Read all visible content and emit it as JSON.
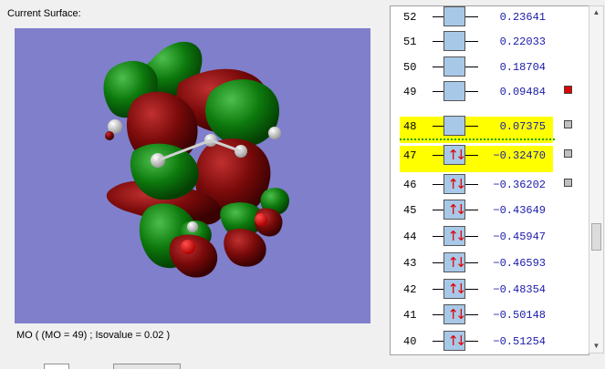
{
  "surface": {
    "title": "Current Surface:",
    "caption": "MO ( (MO = 49) ; Isovalue = 0.02 )"
  },
  "mo_list": {
    "rows": [
      {
        "num": "52",
        "energy": "0.23641",
        "occupied": false,
        "highlight": false,
        "check": ""
      },
      {
        "num": "51",
        "energy": "0.22033",
        "occupied": false,
        "highlight": false,
        "check": ""
      },
      {
        "num": "50",
        "energy": "0.18704",
        "occupied": false,
        "highlight": false,
        "check": ""
      },
      {
        "num": "49",
        "energy": "0.09484",
        "occupied": false,
        "highlight": false,
        "check": "red"
      },
      {
        "num": "48",
        "energy": "0.07375",
        "occupied": false,
        "highlight": true,
        "check": "gray"
      },
      {
        "num": "47",
        "energy": "−0.32470",
        "occupied": true,
        "highlight": true,
        "check": "gray"
      },
      {
        "num": "46",
        "energy": "−0.36202",
        "occupied": true,
        "highlight": false,
        "check": "gray"
      },
      {
        "num": "45",
        "energy": "−0.43649",
        "occupied": true,
        "highlight": false,
        "check": ""
      },
      {
        "num": "44",
        "energy": "−0.45947",
        "occupied": true,
        "highlight": false,
        "check": ""
      },
      {
        "num": "43",
        "energy": "−0.46593",
        "occupied": true,
        "highlight": false,
        "check": ""
      },
      {
        "num": "42",
        "energy": "−0.48354",
        "occupied": true,
        "highlight": false,
        "check": ""
      },
      {
        "num": "41",
        "energy": "−0.50148",
        "occupied": true,
        "highlight": false,
        "check": ""
      },
      {
        "num": "40",
        "energy": "−0.51254",
        "occupied": true,
        "highlight": false,
        "check": ""
      }
    ]
  },
  "colors": {
    "viewport_bg": "#7f7fcc",
    "lobe_positive": "#0d7a0d",
    "lobe_negative": "#7a0a0a",
    "highlight": "#ffff00",
    "energy_text": "#1a1aaa",
    "arrow": "#e00000"
  },
  "icons": {
    "scroll_up": "scroll-up-arrow-icon",
    "scroll_down": "scroll-down-arrow-icon",
    "occupied": "spin-pair-icon"
  }
}
